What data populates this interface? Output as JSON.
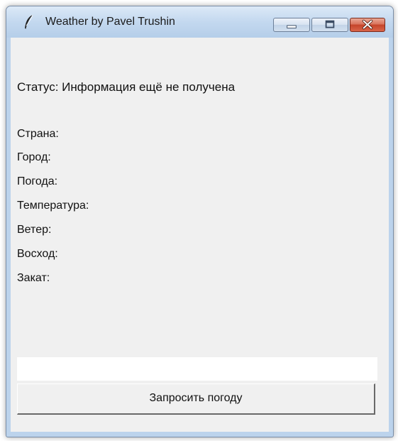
{
  "window": {
    "title": "Weather by Pavel Trushin",
    "icon": "feather-icon",
    "controls": [
      "minimize-icon",
      "maximize-icon",
      "close-icon"
    ]
  },
  "status": {
    "text": "Статус: Информация ещё не получена"
  },
  "fields": {
    "country": "Страна:",
    "city": "Город:",
    "weather": "Погода:",
    "temperature": "Температура:",
    "wind": "Ветер:",
    "sunrise": "Восход:",
    "sunset": "Закат:"
  },
  "input": {
    "value": "",
    "placeholder": ""
  },
  "button": {
    "label": "Запросить погоду"
  },
  "colors": {
    "client_bg": "#f0f0f0",
    "close_button": "#c5442a",
    "frame": "#bcd3ec"
  }
}
